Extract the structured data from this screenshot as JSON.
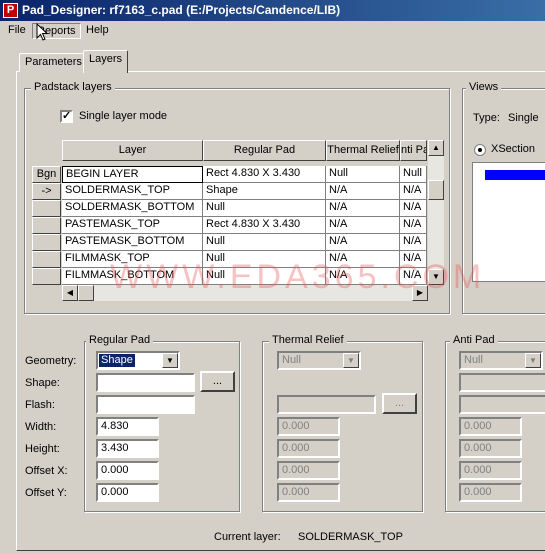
{
  "window": {
    "title": "Pad_Designer: rf7163_c.pad (E:/Projects/Candence/LIB)",
    "app_icon": "pad-designer-app-icon"
  },
  "menu": [
    {
      "label": "File"
    },
    {
      "label": "Reports"
    },
    {
      "label": "Help"
    }
  ],
  "tabs": [
    {
      "label": "Parameters",
      "active": false
    },
    {
      "label": "Layers",
      "active": true
    }
  ],
  "padstack_layers": {
    "legend": "Padstack layers",
    "single_layer_mode": {
      "label": "Single layer mode",
      "checked": true,
      "check_glyph": "✓"
    },
    "columns": [
      "Layer",
      "Regular Pad",
      "Thermal Relief",
      "nti Pa"
    ],
    "row_headers": [
      "Bgn",
      "->",
      "",
      "",
      "",
      "",
      ""
    ],
    "rows": [
      [
        "BEGIN LAYER",
        "Rect 4.830 X 3.430",
        "Null",
        "Null"
      ],
      [
        "SOLDERMASK_TOP",
        "Shape",
        "N/A",
        "N/A"
      ],
      [
        "SOLDERMASK_BOTTOM",
        "Null",
        "N/A",
        "N/A"
      ],
      [
        "PASTEMASK_TOP",
        "Rect 4.830 X 3.430",
        "N/A",
        "N/A"
      ],
      [
        "PASTEMASK_BOTTOM",
        "Null",
        "N/A",
        "N/A"
      ],
      [
        "FILMMASK_TOP",
        "Null",
        "N/A",
        "N/A"
      ],
      [
        "FILMMASK_BOTTOM",
        "Null",
        "N/A",
        "N/A"
      ]
    ]
  },
  "views": {
    "legend": "Views",
    "type_label": "Type:",
    "type_value": "Single",
    "xsection_label": "XSection",
    "accent": "#0000ff"
  },
  "regular_pad": {
    "legend": "Regular Pad",
    "geometry_label": "Geometry:",
    "geometry_value": "Shape",
    "shape_label": "Shape:",
    "shape_value": "",
    "browse_label": "...",
    "flash_label": "Flash:",
    "flash_value": "",
    "width_label": "Width:",
    "width_value": "4.830",
    "height_label": "Height:",
    "height_value": "3.430",
    "offset_x_label": "Offset X:",
    "offset_x_value": "0.000",
    "offset_y_label": "Offset Y:",
    "offset_y_value": "0.000"
  },
  "thermal_relief": {
    "legend": "Thermal Relief",
    "geometry_value": "Null",
    "browse_label": "...",
    "width_value": "0.000",
    "height_value": "0.000",
    "offset_x_value": "0.000",
    "offset_y_value": "0.000"
  },
  "anti_pad": {
    "legend": "Anti Pad",
    "geometry_value": "Null",
    "width_value": "0.000",
    "height_value": "0.000",
    "offset_x_value": "0.000",
    "offset_y_value": "0.000"
  },
  "status": {
    "current_layer_label": "Current layer:",
    "current_layer_value": "SOLDERMASK_TOP"
  },
  "watermark": "WWW.EDA365.COM",
  "colors": {
    "titlebar_start": "#0a246a",
    "titlebar_end": "#3a6ea5",
    "face": "#d4d0c8",
    "selection": "#0a246a"
  }
}
